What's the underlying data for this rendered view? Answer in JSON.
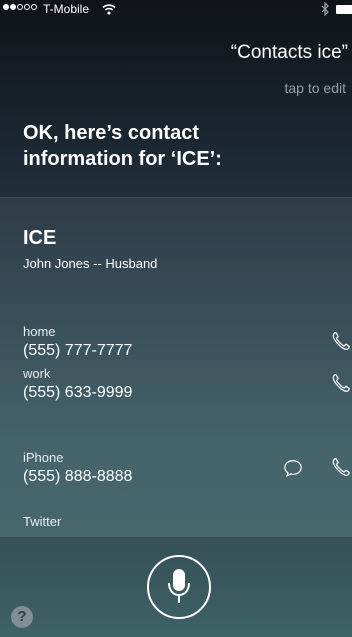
{
  "status_bar": {
    "signal_dots_filled": 2,
    "signal_dots_total": 5,
    "carrier": "T-Mobile"
  },
  "siri": {
    "query": "“Contacts ice”",
    "tap_to_edit": "tap to edit",
    "answer": "OK, here’s contact information for ‘ICE’:"
  },
  "contact": {
    "name": "ICE",
    "subtitle": "John Jones -- Husband",
    "phones": [
      {
        "label": "home",
        "number": "(555) 777-7777",
        "icons": [
          "phone-icon"
        ]
      },
      {
        "label": "work",
        "number": "(555) 633-9999",
        "icons": [
          "phone-icon"
        ]
      },
      {
        "label": "iPhone",
        "number": "(555) 888-8888",
        "icons": [
          "message-icon",
          "phone-icon"
        ]
      }
    ],
    "twitter_label": "Twitter"
  },
  "bottom": {
    "help": "?"
  },
  "colors": {
    "background_top": "#101318",
    "background_bottom": "#3e6166",
    "secondary_text": "#8fa0a8"
  }
}
